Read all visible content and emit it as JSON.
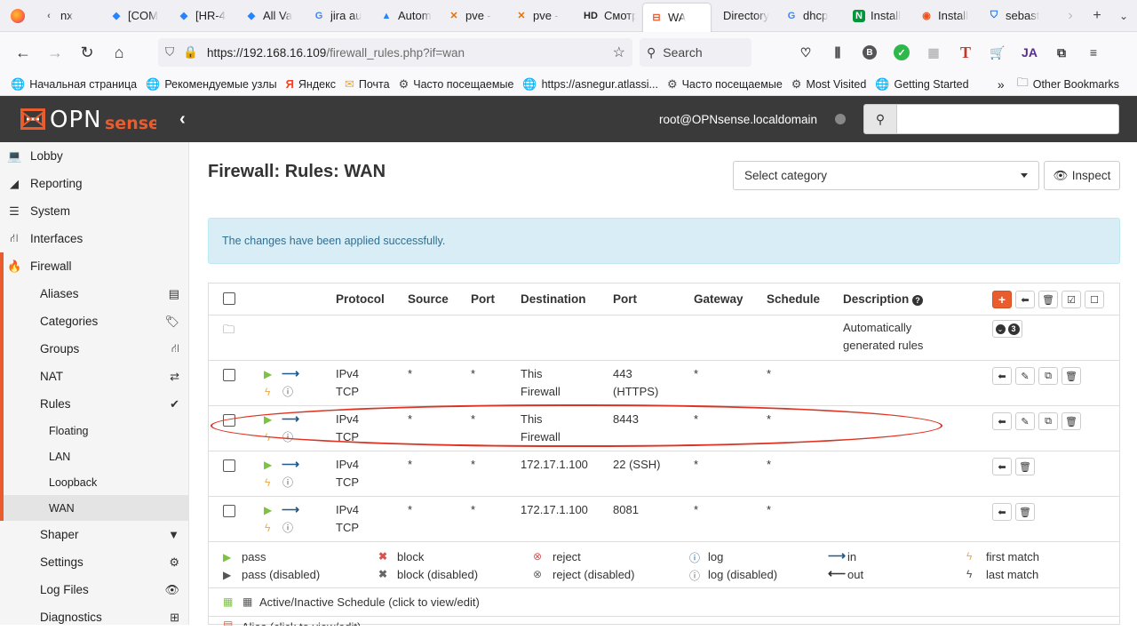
{
  "browser": {
    "tabs": [
      {
        "label": "nx",
        "icon": "back-icon"
      },
      {
        "label": "[COM",
        "icon": "jira-icon"
      },
      {
        "label": "[HR-4",
        "icon": "jira-icon"
      },
      {
        "label": "All Va",
        "icon": "jira-icon"
      },
      {
        "label": "jira au",
        "icon": "google-icon"
      },
      {
        "label": "Autom",
        "icon": "atlassian-icon"
      },
      {
        "label": "pve -",
        "icon": "proxmox-icon"
      },
      {
        "label": "pve -",
        "icon": "proxmox-icon"
      },
      {
        "label": "Смотр",
        "icon": "hd-icon"
      },
      {
        "label": "WA",
        "icon": "opnsense-icon"
      },
      {
        "label": "Directory",
        "icon": ""
      },
      {
        "label": "dhcp",
        "icon": "google-icon"
      },
      {
        "label": "Install",
        "icon": "nginx-icon"
      },
      {
        "label": "Install",
        "icon": "ubuntu-icon"
      },
      {
        "label": "sebast",
        "icon": "shield-icon"
      }
    ],
    "url_host": "https://192.168.16.109",
    "url_path": "/firewall_rules.php?if=wan",
    "search_placeholder": "Search",
    "bookmarks": [
      "Начальная страница",
      "Рекомендуемые узлы",
      "Яндекс",
      "Почта",
      "Часто посещаемые",
      "https://asnegur.atlassi...",
      "Часто посещаемые",
      "Most Visited",
      "Getting Started"
    ],
    "other_bookmarks": "Other Bookmarks"
  },
  "header": {
    "user": "root@OPNsense.localdomain"
  },
  "sidebar": {
    "top": [
      {
        "label": "Lobby",
        "icon": "laptop-icon"
      },
      {
        "label": "Reporting",
        "icon": "area-chart-icon"
      },
      {
        "label": "System",
        "icon": "server-icon"
      },
      {
        "label": "Interfaces",
        "icon": "sitemap-icon"
      },
      {
        "label": "Firewall",
        "icon": "fire-icon"
      }
    ],
    "firewall_sub": [
      {
        "label": "Aliases",
        "icon": "list-icon"
      },
      {
        "label": "Categories",
        "icon": "tags-icon"
      },
      {
        "label": "Groups",
        "icon": "sitemap-icon"
      },
      {
        "label": "NAT",
        "icon": "exchange-icon"
      },
      {
        "label": "Rules",
        "icon": "check-icon"
      }
    ],
    "rules_sub": [
      "Floating",
      "LAN",
      "Loopback",
      "WAN"
    ],
    "after": [
      {
        "label": "Shaper",
        "icon": "filter-icon"
      },
      {
        "label": "Settings",
        "icon": "cogs-icon"
      },
      {
        "label": "Log Files",
        "icon": "eye-icon"
      },
      {
        "label": "Diagnostics",
        "icon": "medkit-icon"
      }
    ]
  },
  "page": {
    "title": "Firewall: Rules: WAN",
    "category_placeholder": "Select category",
    "inspect_label": "Inspect",
    "alert": "The changes have been applied successfully."
  },
  "table": {
    "headers": {
      "protocol": "Protocol",
      "source": "Source",
      "port": "Port",
      "destination": "Destination",
      "dport": "Port",
      "gateway": "Gateway",
      "schedule": "Schedule",
      "description": "Description"
    },
    "auto_rules": {
      "line1": "Automatically",
      "line2": "generated rules",
      "count": "3"
    },
    "rows": [
      {
        "proto1": "IPv4",
        "proto2": "TCP",
        "source": "*",
        "sport": "*",
        "dest1": "This",
        "dest2": "Firewall",
        "dport1": "443",
        "dport2": "(HTTPS)",
        "gateway": "*",
        "schedule": "*",
        "full_actions": true
      },
      {
        "proto1": "IPv4",
        "proto2": "TCP",
        "source": "*",
        "sport": "*",
        "dest1": "This",
        "dest2": "Firewall",
        "dport1": "8443",
        "dport2": "",
        "gateway": "*",
        "schedule": "*",
        "full_actions": true
      },
      {
        "proto1": "IPv4",
        "proto2": "TCP",
        "source": "*",
        "sport": "*",
        "dest1": "172.17.1.100",
        "dest2": "",
        "dport1": "22 (SSH)",
        "dport2": "",
        "gateway": "*",
        "schedule": "*",
        "full_actions": false
      },
      {
        "proto1": "IPv4",
        "proto2": "TCP",
        "source": "*",
        "sport": "*",
        "dest1": "172.17.1.100",
        "dest2": "",
        "dport1": "8081",
        "dport2": "",
        "gateway": "*",
        "schedule": "*",
        "full_actions": false
      }
    ]
  },
  "legend": {
    "pass": "pass",
    "pass_disabled": "pass (disabled)",
    "block": "block",
    "block_disabled": "block (disabled)",
    "reject": "reject",
    "reject_disabled": "reject (disabled)",
    "log": "log",
    "log_disabled": "log (disabled)",
    "in": "in",
    "out": "out",
    "first_match": "first match",
    "last_match": "last match",
    "schedule": "Active/Inactive Schedule (click to view/edit)",
    "alias": "Alias (click to view/edit)"
  },
  "colors": {
    "brand": "#e95c2d",
    "pass": "#7dc242",
    "block": "#d9534f",
    "highlight": "#dd3322"
  }
}
